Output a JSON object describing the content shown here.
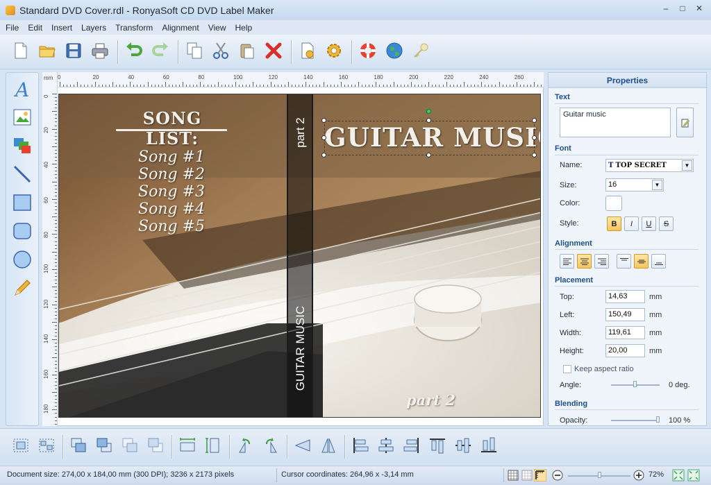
{
  "window": {
    "title": "Standard DVD Cover.rdl - RonyaSoft CD DVD Label Maker",
    "buttons": [
      "–",
      "□",
      "✕"
    ]
  },
  "menu": [
    "File",
    "Edit",
    "Insert",
    "Layers",
    "Transform",
    "Alignment",
    "View",
    "Help"
  ],
  "toolbar": [
    {
      "name": "new-document-icon"
    },
    {
      "name": "open-folder-icon"
    },
    {
      "name": "save-icon"
    },
    {
      "name": "print-icon"
    },
    {
      "sep": true
    },
    {
      "name": "undo-icon"
    },
    {
      "name": "redo-icon"
    },
    {
      "sep": true
    },
    {
      "name": "copy-icon"
    },
    {
      "name": "cut-icon"
    },
    {
      "name": "paste-icon"
    },
    {
      "name": "delete-icon"
    },
    {
      "sep": true
    },
    {
      "name": "document-settings-icon"
    },
    {
      "name": "options-gear-icon"
    },
    {
      "sep": true
    },
    {
      "name": "help-lifebuoy-icon"
    },
    {
      "name": "web-globe-icon"
    },
    {
      "name": "register-key-icon"
    }
  ],
  "tools": [
    "text-tool-icon",
    "image-tool-icon",
    "layers-tool-icon",
    "line-tool-icon",
    "rectangle-tool-icon",
    "rounded-rectangle-tool-icon",
    "ellipse-tool-icon",
    "pencil-tool-icon"
  ],
  "ruler": {
    "unit": "mm",
    "top_ticks": [
      "0",
      "20",
      "40",
      "60",
      "80",
      "100",
      "120",
      "140",
      "160",
      "180",
      "200",
      "220",
      "240",
      "260"
    ],
    "left_ticks": [
      "0",
      "20",
      "40",
      "60",
      "80",
      "100",
      "120",
      "140",
      "160",
      "180"
    ]
  },
  "cover": {
    "song_list_title": "SONG LIST:",
    "songs": [
      "Song #1",
      "Song #2",
      "Song #3",
      "Song #4",
      "Song #5"
    ],
    "spine_top": "part 2",
    "spine_bottom": "GUITAR MUSIC",
    "main_title": "GUITAR MUSIC",
    "part_label": "part 2"
  },
  "properties": {
    "header": "Properties",
    "text_section": "Text",
    "text_value": "Guitar music",
    "font_section": "Font",
    "name_label": "Name:",
    "font_name": "TOP SECRET",
    "size_label": "Size:",
    "size_value": "16",
    "color_label": "Color:",
    "color_value": "#ffffff",
    "style_label": "Style:",
    "style_buttons": [
      "B",
      "I",
      "U",
      "S"
    ],
    "alignment_section": "Alignment",
    "placement_section": "Placement",
    "top_label": "Top:",
    "top_value": "14,63",
    "left_label": "Left:",
    "left_value": "150,49",
    "width_label": "Width:",
    "width_value": "119,61",
    "height_label": "Height:",
    "height_value": "20,00",
    "unit": "mm",
    "keep_aspect_label": "Keep aspect ratio",
    "keep_aspect_checked": false,
    "angle_label": "Angle:",
    "angle_value": "0 deg.",
    "blending_section": "Blending",
    "opacity_label": "Opacity:",
    "opacity_value": "100 %"
  },
  "bottom_toolbar": [
    {
      "name": "group-icon"
    },
    {
      "name": "ungroup-icon"
    },
    {
      "sep": true
    },
    {
      "name": "bring-to-front-icon"
    },
    {
      "name": "send-to-back-icon"
    },
    {
      "name": "bring-forward-icon"
    },
    {
      "name": "send-backward-icon"
    },
    {
      "sep": true
    },
    {
      "name": "same-width-icon"
    },
    {
      "name": "same-height-icon"
    },
    {
      "sep": true
    },
    {
      "name": "rotate-left-icon"
    },
    {
      "name": "rotate-right-icon"
    },
    {
      "sep": true
    },
    {
      "name": "flip-horizontal-icon"
    },
    {
      "name": "flip-vertical-icon"
    },
    {
      "sep": true
    },
    {
      "name": "align-left-icon"
    },
    {
      "name": "align-center-icon"
    },
    {
      "name": "align-right-icon"
    },
    {
      "name": "align-top-icon"
    },
    {
      "name": "align-middle-icon"
    },
    {
      "name": "align-bottom-icon"
    }
  ],
  "status": {
    "document": "Document size: 274,00 x 184,00 mm (300 DPI); 3236 x 2173 pixels",
    "cursor": "Cursor coordinates: 264,96 x -3,14 mm",
    "zoom": "72%",
    "zoom_level": 0.72
  }
}
